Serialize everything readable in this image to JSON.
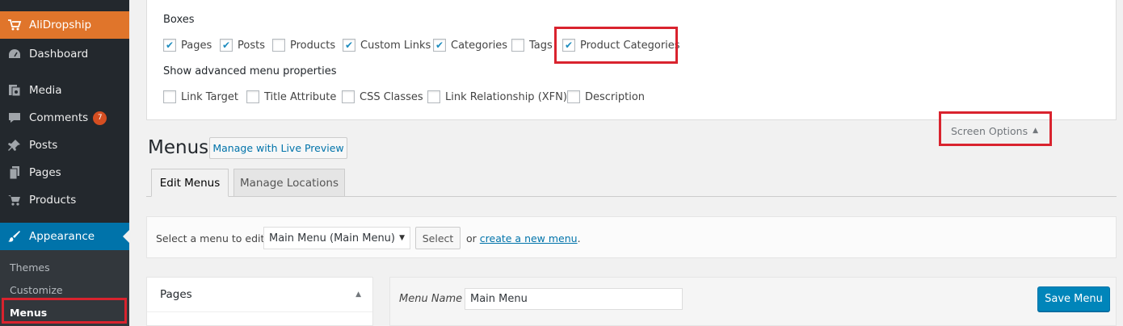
{
  "sidebar": {
    "items": [
      {
        "label": "AliDropship",
        "icon": "cart-icon"
      },
      {
        "label": "Dashboard",
        "icon": "dashboard-icon"
      },
      {
        "label": "Media",
        "icon": "media-icon"
      },
      {
        "label": "Comments",
        "icon": "comment-icon",
        "badge": "7"
      },
      {
        "label": "Posts",
        "icon": "pin-icon"
      },
      {
        "label": "Pages",
        "icon": "pages-icon"
      },
      {
        "label": "Products",
        "icon": "cart-icon"
      },
      {
        "label": "Appearance",
        "icon": "brush-icon"
      }
    ],
    "submenu": [
      "Themes",
      "Customize",
      "Menus"
    ]
  },
  "screen_options": {
    "boxes_label": "Boxes",
    "boxes": [
      {
        "label": "Pages",
        "checked": true
      },
      {
        "label": "Posts",
        "checked": true
      },
      {
        "label": "Products",
        "checked": false
      },
      {
        "label": "Custom Links",
        "checked": true
      },
      {
        "label": "Categories",
        "checked": true
      },
      {
        "label": "Tags",
        "checked": false
      },
      {
        "label": "Product Categories",
        "checked": true
      }
    ],
    "advanced_label": "Show advanced menu properties",
    "advanced": [
      {
        "label": "Link Target",
        "checked": false
      },
      {
        "label": "Title Attribute",
        "checked": false
      },
      {
        "label": "CSS Classes",
        "checked": false
      },
      {
        "label": "Link Relationship (XFN)",
        "checked": false
      },
      {
        "label": "Description",
        "checked": false
      }
    ],
    "tab_label": "Screen Options"
  },
  "header": {
    "title": "Menus",
    "live_preview": "Manage with Live Preview"
  },
  "tabs": [
    "Edit Menus",
    "Manage Locations"
  ],
  "select_bar": {
    "prompt": "Select a menu to edit:",
    "selected": "Main Menu (Main Menu)",
    "select_button": "Select",
    "or_text": "or",
    "create_link": "create a new menu",
    "period": "."
  },
  "pages_panel": {
    "title": "Pages"
  },
  "menu_panel": {
    "name_label": "Menu Name",
    "name_value": "Main Menu",
    "save_label": "Save Menu"
  },
  "colors": {
    "sidebar_bg": "#23282d",
    "accent_orange": "#e0752b",
    "active_blue": "#0073aa",
    "highlight_red": "#d9232e"
  }
}
